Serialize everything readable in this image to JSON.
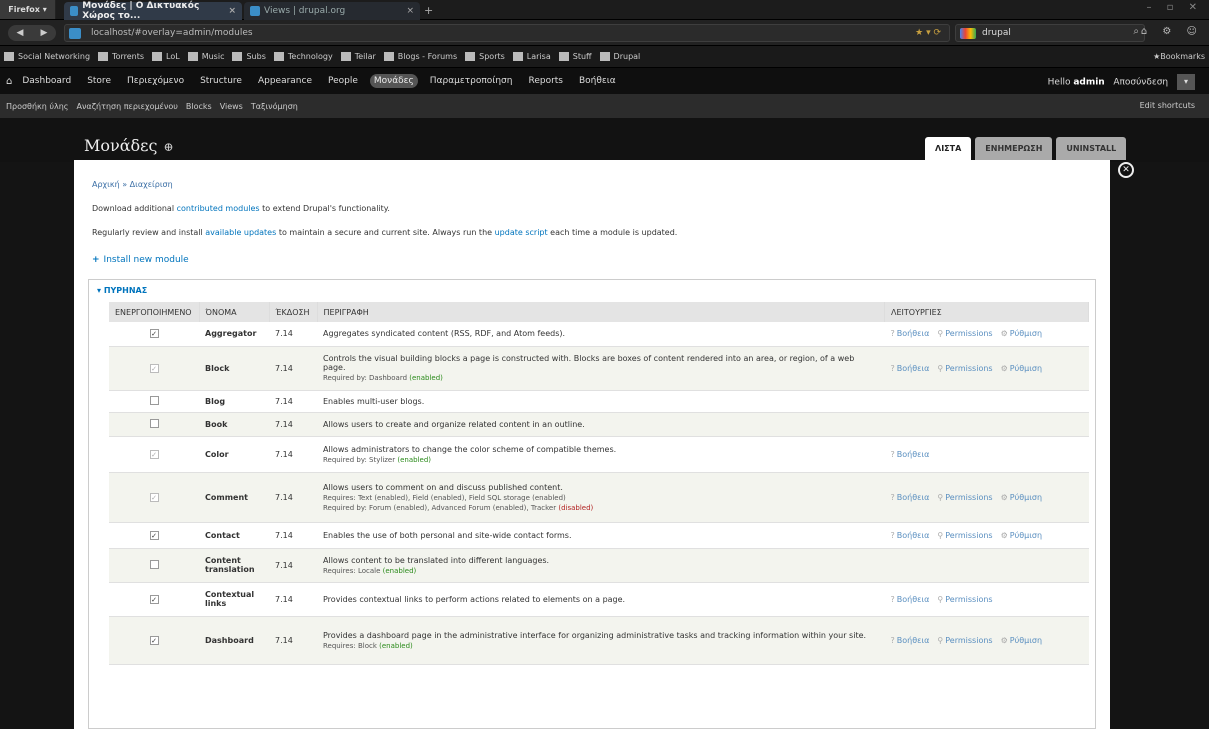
{
  "browser": {
    "firefox_label": "Firefox ▾",
    "tabs": [
      {
        "label": "Μονάδες | Ο Δικτυακός Χώρος το...",
        "active": true
      },
      {
        "label": "Views | drupal.org",
        "active": false
      }
    ],
    "url": "localhost/#overlay=admin/modules",
    "search_value": "drupal",
    "bookmarks": [
      "Social Networking",
      "Torrents",
      "LoL",
      "Music",
      "Subs",
      "Technology",
      "Teilar",
      "Blogs - Forums",
      "Sports",
      "Larisa",
      "Stuff",
      "Drupal"
    ],
    "bookmarks_right": "Bookmarks"
  },
  "admin_toolbar": {
    "items": [
      "Dashboard",
      "Store",
      "Περιεχόμενο",
      "Structure",
      "Appearance",
      "People",
      "Μονάδες",
      "Παραμετροποίηση",
      "Reports",
      "Βοήθεια"
    ],
    "active_index": 6,
    "hello_prefix": "Hello",
    "user": "admin",
    "logout": "Αποσύνδεση"
  },
  "shortcuts": {
    "items": [
      "Προσθήκη ύλης",
      "Αναζήτηση περιεχομένου",
      "Blocks",
      "Views",
      "Ταξινόμηση"
    ],
    "edit": "Edit shortcuts"
  },
  "page": {
    "title": "Μονάδες",
    "tabs": [
      "ΛΙΣΤΑ",
      "ΕΝΗΜΕΡΩΣΗ",
      "UNINSTALL"
    ],
    "breadcrumb": "Αρχική » Διαχείριση",
    "p1_a": "Download additional ",
    "p1_link": "contributed modules",
    "p1_b": " to extend Drupal's functionality.",
    "p2_a": "Regularly review and install ",
    "p2_link1": "available updates",
    "p2_b": " to maintain a secure and current site. Always run the ",
    "p2_link2": "update script",
    "p2_c": " each time a module is updated.",
    "install": "Install new module",
    "fieldset": "ΠΥΡΗΝΑΣ"
  },
  "table": {
    "headers": [
      "ΕΝΕΡΓΟΠΟΙΗΜΕΝΟ",
      "ΌΝΟΜΑ",
      "ΈΚΔΟΣΗ",
      "ΠΕΡΙΓΡΑΦΗ",
      "ΛΕΙΤΟΥΡΓΙΕΣ"
    ],
    "rows": [
      {
        "name": "Aggregator",
        "ver": "7.14",
        "desc": "Aggregates syndicated content (RSS, RDF, and Atom feeds).",
        "checked": true,
        "disabled": false,
        "ops": [
          "Βοήθεια",
          "Permissions",
          "Ρύθμιση"
        ]
      },
      {
        "name": "Block",
        "ver": "7.14",
        "desc": "Controls the visual building blocks a page is constructed with. Blocks are boxes of content rendered into an area, or region, of a web page.",
        "req": "Required by: Dashboard",
        "req_en": "(enabled)",
        "checked": true,
        "disabled": true,
        "ops": [
          "Βοήθεια",
          "Permissions",
          "Ρύθμιση"
        ]
      },
      {
        "name": "Blog",
        "ver": "7.14",
        "desc": "Enables multi-user blogs.",
        "checked": false,
        "disabled": false,
        "ops": []
      },
      {
        "name": "Book",
        "ver": "7.14",
        "desc": "Allows users to create and organize related content in an outline.",
        "checked": false,
        "disabled": false,
        "ops": []
      },
      {
        "name": "Color",
        "ver": "7.14",
        "desc": "Allows administrators to change the color scheme of compatible themes.",
        "req": "Required by: Stylizer",
        "req_en": "(enabled)",
        "checked": true,
        "disabled": true,
        "ops": [
          "Βοήθεια"
        ]
      },
      {
        "name": "Comment",
        "ver": "7.14",
        "desc": "Allows users to comment on and discuss published content.",
        "checked": true,
        "disabled": true,
        "ops": [
          "Βοήθεια",
          "Permissions",
          "Ρύθμιση"
        ]
      },
      {
        "name": "Contact",
        "ver": "7.14",
        "desc": "Enables the use of both personal and site-wide contact forms.",
        "checked": true,
        "disabled": false,
        "ops": [
          "Βοήθεια",
          "Permissions",
          "Ρύθμιση"
        ]
      },
      {
        "name": "Content translation",
        "ver": "7.14",
        "desc": "Allows content to be translated into different languages.",
        "req": "Requires: Locale",
        "req_en": "(enabled)",
        "checked": false,
        "disabled": false,
        "ops": []
      },
      {
        "name": "Contextual links",
        "ver": "7.14",
        "desc": "Provides contextual links to perform actions related to elements on a page.",
        "checked": true,
        "disabled": false,
        "ops": [
          "Βοήθεια",
          "Permissions"
        ]
      },
      {
        "name": "Dashboard",
        "ver": "7.14",
        "desc": "Provides a dashboard page in the administrative interface for organizing administrative tasks and tracking information within your site.",
        "req": "Requires: Block",
        "req_en": "(enabled)",
        "checked": true,
        "disabled": false,
        "ops": [
          "Βοήθεια",
          "Permissions",
          "Ρύθμιση"
        ]
      }
    ],
    "comment_req1": "Requires: Text (enabled), Field (enabled), Field SQL storage (enabled)",
    "comment_req2_a": "Required by: Forum (enabled), Advanced Forum (enabled), Tracker",
    "comment_req2_dis": "(disabled)"
  }
}
